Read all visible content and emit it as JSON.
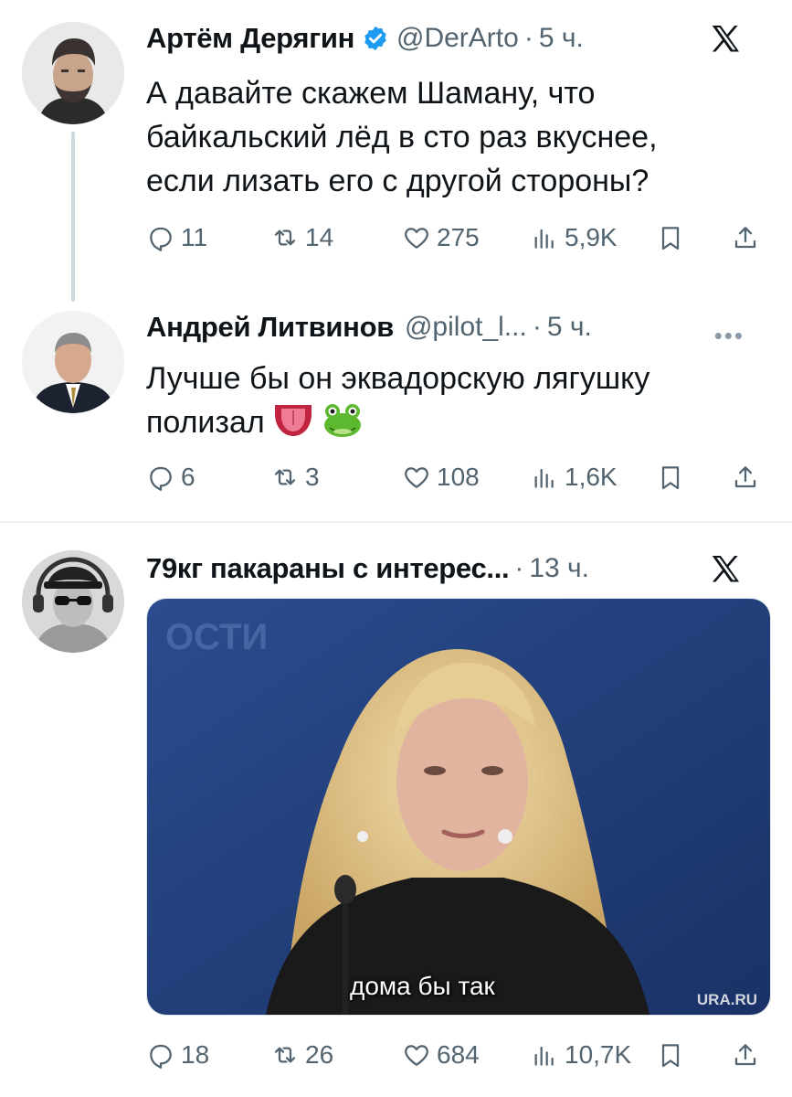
{
  "tweets": [
    {
      "author": "Артём Дерягин",
      "handle": "@DerArto",
      "time": "5 ч.",
      "text_lines": [
        "А давайте скажем Шаману, что",
        "байкальский лёд в сто раз вкуснее,",
        "если лизать его с другой стороны?"
      ],
      "verified": true,
      "corner_icon": "x-logo-icon",
      "replies": "11",
      "retweets": "14",
      "likes": "275",
      "views": "5,9K"
    },
    {
      "author": "Андрей Литвинов",
      "handle": "@pilot_l...",
      "time": "5 ч.",
      "text_lines": [
        "Лучше бы он эквадорскую лягушку",
        "полизал"
      ],
      "emojis": [
        "tongue-emoji",
        "frog-emoji"
      ],
      "corner_icon": "more-icon",
      "replies": "6",
      "retweets": "3",
      "likes": "108",
      "views": "1,6K"
    },
    {
      "author": "79кг пакараны с интерес...",
      "time": "13 ч.",
      "corner_icon": "x-logo-icon",
      "media": {
        "caption": "дома бы так",
        "watermark": "URA.RU"
      },
      "replies": "18",
      "retweets": "26",
      "likes": "684",
      "views": "10,7K"
    }
  ],
  "colors": {
    "text": "#0f1419",
    "secondary": "#536471",
    "verified_blue": "#1d9bf0",
    "divider": "#eff3f4",
    "thread_line": "#cfd9de"
  },
  "icons": [
    "reply-icon",
    "retweet-icon",
    "like-icon",
    "views-icon",
    "bookmark-icon",
    "share-icon",
    "verified-icon"
  ]
}
